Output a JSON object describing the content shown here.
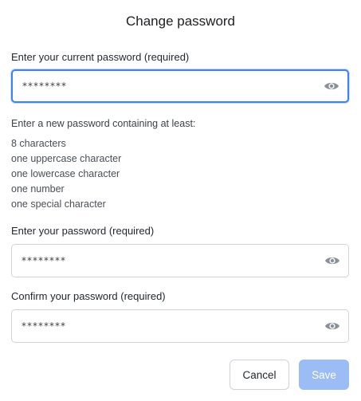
{
  "dialog": {
    "title": "Change password",
    "current_password": {
      "label": "Enter your current password (required)",
      "value": "********",
      "icon": "eye-icon"
    },
    "requirements": {
      "heading": "Enter a new password containing at least:",
      "items": [
        "8 characters",
        "one uppercase character",
        "one lowercase character",
        "one number",
        "one special character"
      ]
    },
    "new_password": {
      "label": "Enter your password (required)",
      "value": "********",
      "icon": "eye-icon"
    },
    "confirm_password": {
      "label": "Confirm your password (required)",
      "value": "********",
      "icon": "eye-icon"
    },
    "buttons": {
      "cancel": "Cancel",
      "save": "Save"
    }
  },
  "colors": {
    "focus_border": "#3b82f6",
    "save_disabled": "#9bbcf5",
    "icon": "#8a9097"
  }
}
